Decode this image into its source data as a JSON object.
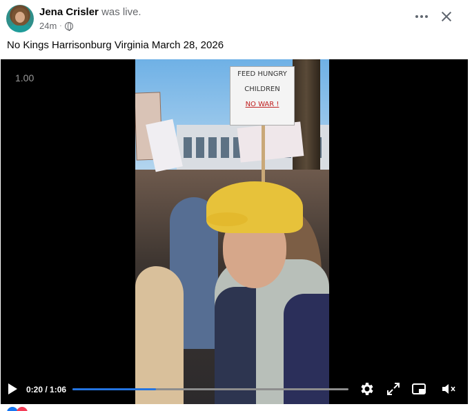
{
  "post": {
    "author": "Jena Crisler",
    "status": "was live.",
    "time": "24m",
    "dot": "·",
    "caption": "No Kings Harrisonburg Virginia March 28, 2026"
  },
  "video": {
    "zoom": "1.00",
    "time_display": "0:20 / 1:06",
    "progress": 0.303,
    "sign_lines": [
      "FEED HUNGRY",
      "CHILDREN",
      "NO WAR !"
    ]
  },
  "icons": {
    "play": "play-icon",
    "settings": "gear-icon",
    "fullscreen": "expand-icon",
    "pip": "picture-in-picture-icon",
    "mute": "volume-muted-icon",
    "more": "more-horizontal-icon",
    "close": "close-icon",
    "privacy": "globe-icon"
  },
  "colors": {
    "progress_fill": "#2374e1",
    "reaction_like": "#1877f2",
    "reaction_love": "#f33e58"
  }
}
